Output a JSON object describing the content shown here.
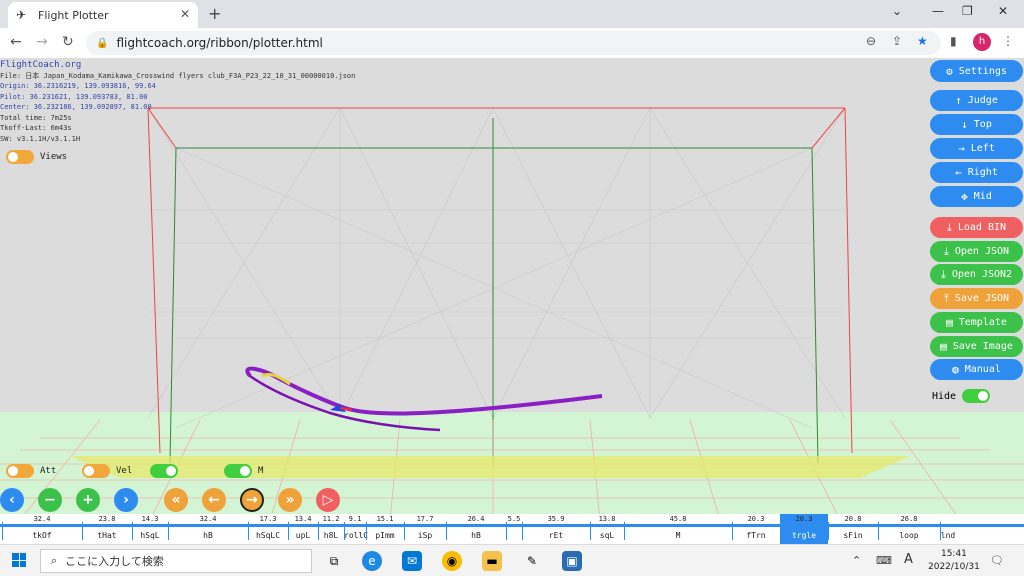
{
  "browser": {
    "tab_title": "Flight Plotter",
    "url": "flightcoach.org/ribbon/plotter.html",
    "avatar_letter": "h"
  },
  "info": {
    "site": "FlightCoach.org",
    "file": "File: 日本 Japan_Kodama_Kamikawa_Crosswind flyers club_F3A_P23_22_10_31_00000010.json",
    "origin": "Origin: 36.2316219, 139.093816, 99.64",
    "pilot": "Pilot: 36.231621, 139.093783, 81.00",
    "center": "Center: 36.232186, 139.092897, 81.00",
    "total_time": "Total time: 7m25s",
    "tkoff_last": "Tkoff-Last: 6m43s",
    "sw": "SW: v3.1.1H/v3.1.1H"
  },
  "toggles": {
    "views": "Views",
    "att": "Att",
    "vel": "Vel",
    "m": "M",
    "hide": "Hide"
  },
  "sidebar": {
    "settings": "Settings",
    "judge": "Judge",
    "top": "Top",
    "left": "Left",
    "right": "Right",
    "mid": "Mid",
    "load_bin": "Load BIN",
    "open_json": "Open JSON",
    "open_json2": "Open JSON2",
    "save_json": "Save JSON",
    "template": "Template",
    "save_image": "Save Image",
    "manual": "Manual"
  },
  "timeline": [
    {
      "value": "32.4",
      "label": "tkOf"
    },
    {
      "value": "23.8",
      "label": "tHat"
    },
    {
      "value": "14.3",
      "label": "hSqL"
    },
    {
      "value": "32.4",
      "label": "hB"
    },
    {
      "value": "17.3",
      "label": "hSqLC"
    },
    {
      "value": "13.4",
      "label": "upL"
    },
    {
      "value": "11.2",
      "label": "h8L"
    },
    {
      "value": "9.1",
      "label": "rollC"
    },
    {
      "value": "15.1",
      "label": "pImm"
    },
    {
      "value": "17.7",
      "label": "iSp"
    },
    {
      "value": "26.4",
      "label": "hB"
    },
    {
      "value": "5.5",
      "label": ""
    },
    {
      "value": "35.9",
      "label": "rEt"
    },
    {
      "value": "13.8",
      "label": "sqL"
    },
    {
      "value": "45.8",
      "label": "M"
    },
    {
      "value": "20.3",
      "label": "fTrn"
    },
    {
      "value": "20.3",
      "label": "trgle"
    },
    {
      "value": "20.8",
      "label": "sFin"
    },
    {
      "value": "26.8",
      "label": "loop"
    },
    {
      "value": "",
      "label": "lnd"
    }
  ],
  "taskbar": {
    "search_placeholder": "ここに入力して検索",
    "time": "15:41",
    "date": "2022/10/31",
    "ime": "A"
  }
}
